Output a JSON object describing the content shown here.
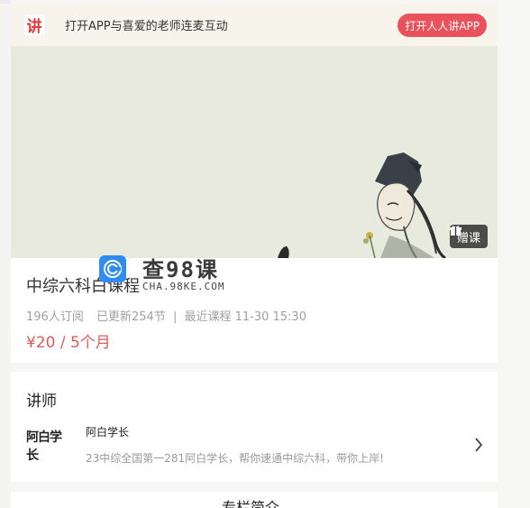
{
  "app_banner": {
    "logo_char": "讲",
    "text": "打开APP与喜爱的老师连麦互动",
    "open_button": "打开人人讲APP"
  },
  "hero": {
    "gift_button": "赠课",
    "gift_icon": "gift-icon"
  },
  "watermark": {
    "title": "查98课",
    "subtitle": "CHA.98KE.COM"
  },
  "course": {
    "title": "中综六科白课程",
    "subscribers": "196人订阅",
    "updated": "已更新254节",
    "separator": "|",
    "recent": "最近课程 11-30 15:30",
    "price": "¥20 / 5个月"
  },
  "teacher_section": {
    "title": "讲师",
    "avatar_text": "阿白学长",
    "name": "阿白学长",
    "description": "23中综全国第一281阿白学长，帮你速通中综六科，带你上岸!"
  },
  "bottom_section": {
    "title": "专栏简介"
  },
  "colors": {
    "accent": "#e9525a",
    "price": "#e05a5a",
    "banner_bg": "#f7f4ec",
    "hero_bg": "#e7eadc"
  }
}
